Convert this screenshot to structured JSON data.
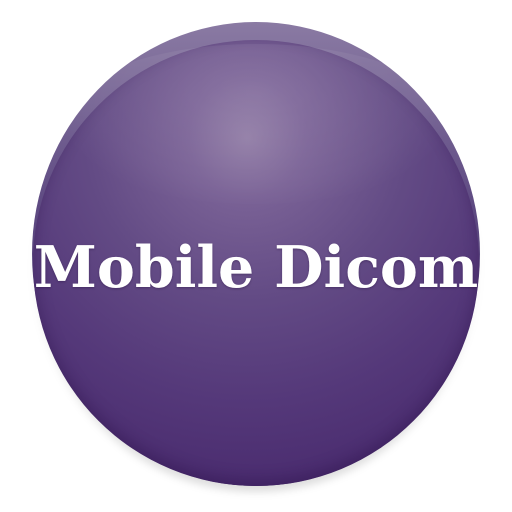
{
  "app_icon": {
    "title": "Mobile Dicom",
    "colors": {
      "background": "#ffffff",
      "disc_light": "#8f7aa4",
      "disc_mid": "#634b85",
      "disc_dark": "#46286a",
      "text": "#ffffff"
    }
  }
}
